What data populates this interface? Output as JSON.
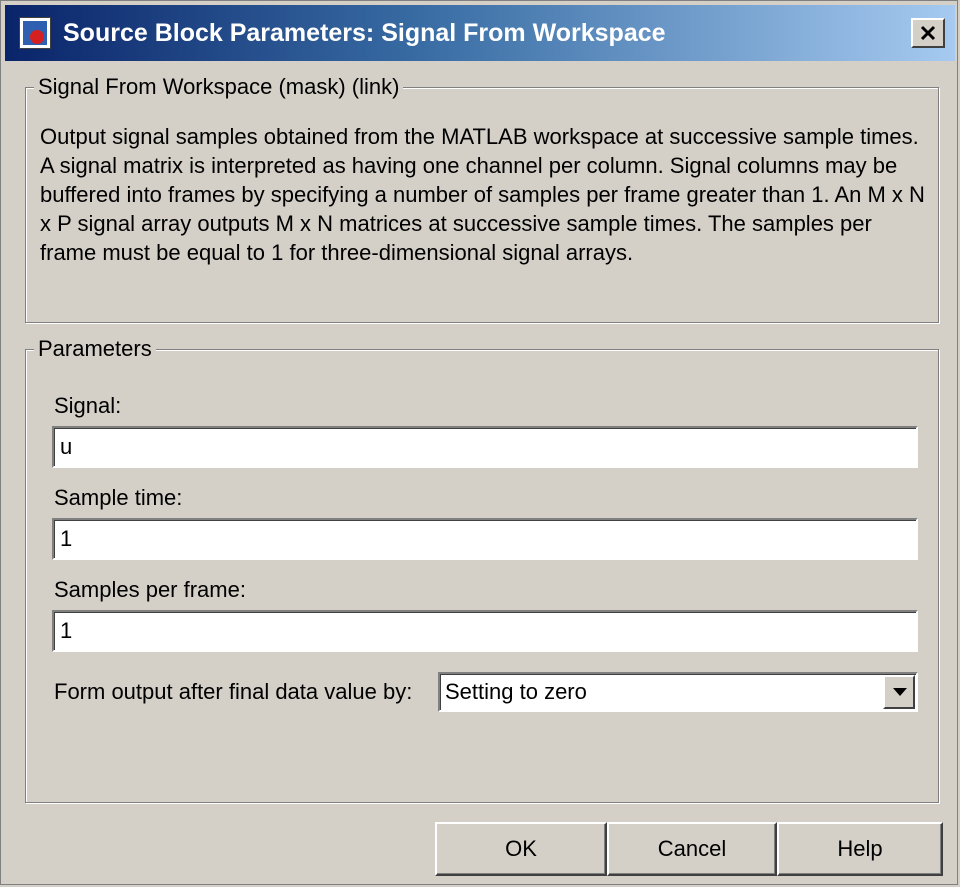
{
  "window": {
    "title": "Source Block Parameters: Signal From Workspace",
    "icon": "simulink-block-icon",
    "close_icon": "close-icon"
  },
  "mask_group": {
    "legend": "Signal From Workspace (mask) (link)",
    "description": "Output signal samples obtained from the MATLAB workspace at successive sample times. A signal matrix is interpreted as having one channel per column. Signal columns may be buffered into frames by specifying a number of samples per frame greater than 1. An M x N x P signal array outputs M x N matrices at successive sample times. The samples per frame must be equal to 1 for three-dimensional signal arrays."
  },
  "parameters_group": {
    "legend": "Parameters",
    "signal": {
      "label": "Signal:",
      "value": "u"
    },
    "sample_time": {
      "label": "Sample time:",
      "value": "1"
    },
    "samples_per_frame": {
      "label": "Samples per frame:",
      "value": "1"
    },
    "form_output": {
      "label": "Form output after final data value by:",
      "selected": "Setting to zero",
      "dropdown_icon": "chevron-down-icon"
    }
  },
  "buttons": {
    "ok": "OK",
    "cancel": "Cancel",
    "help": "Help"
  }
}
